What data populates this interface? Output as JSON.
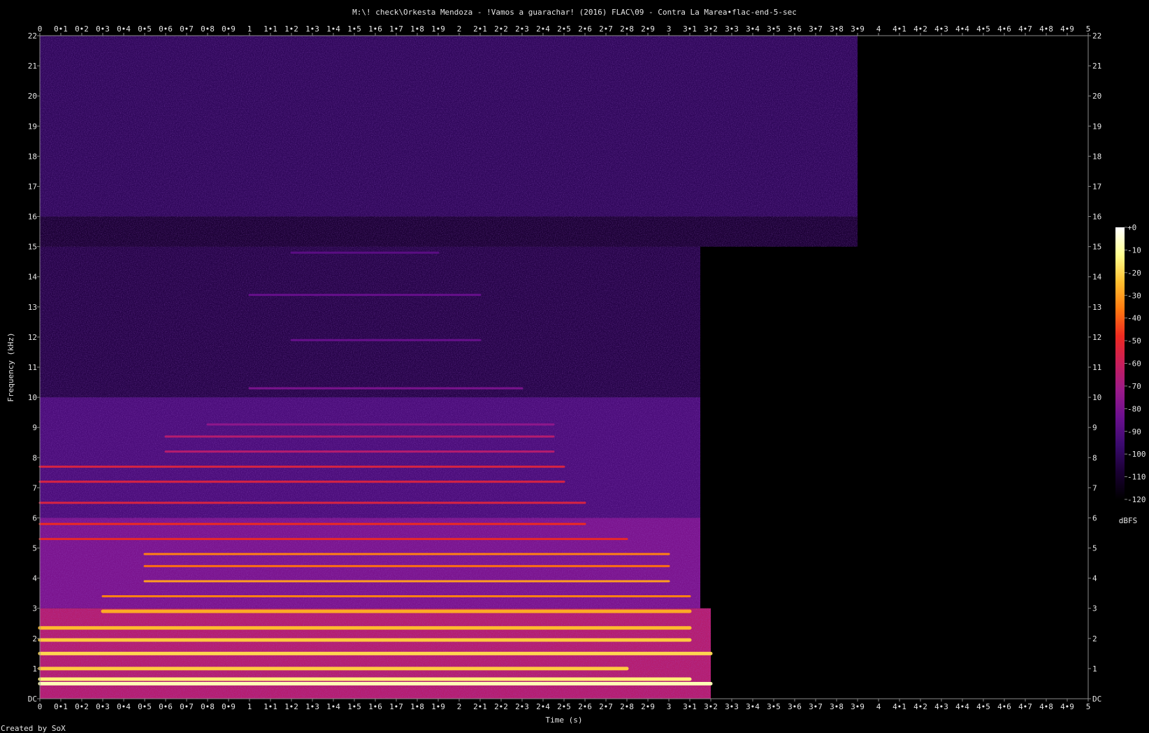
{
  "chart_data": {
    "type": "heatmap",
    "title": "M:\\! check\\Orkesta Mendoza - !Vamos a guarachar! (2016) FLAC\\09 - Contra La Marea•flac-end-5-sec",
    "xlabel": "Time (s)",
    "ylabel": "Frequency (kHz)",
    "xlim": [
      0,
      5
    ],
    "ylim": [
      0,
      22
    ],
    "x_ticks": [
      "0",
      "0•1",
      "0•2",
      "0•3",
      "0•4",
      "0•5",
      "0•6",
      "0•7",
      "0•8",
      "0•9",
      "1",
      "1•1",
      "1•2",
      "1•3",
      "1•4",
      "1•5",
      "1•6",
      "1•7",
      "1•8",
      "1•9",
      "2",
      "2•1",
      "2•2",
      "2•3",
      "2•4",
      "2•5",
      "2•6",
      "2•7",
      "2•8",
      "2•9",
      "3",
      "3•1",
      "3•2",
      "3•3",
      "3•4",
      "3•5",
      "3•6",
      "3•7",
      "3•8",
      "3•9",
      "4",
      "4•1",
      "4•2",
      "4•3",
      "4•4",
      "4•5",
      "4•6",
      "4•7",
      "4•8",
      "4•9",
      "5"
    ],
    "y_ticks": [
      "DC",
      "1",
      "2",
      "3",
      "4",
      "5",
      "6",
      "7",
      "8",
      "9",
      "10",
      "11",
      "12",
      "13",
      "14",
      "15",
      "16",
      "17",
      "18",
      "19",
      "20",
      "21",
      "22"
    ],
    "colorbar": {
      "label": "dBFS",
      "ticks": [
        "+0",
        "-10",
        "-20",
        "-30",
        "-40",
        "-50",
        "-60",
        "-70",
        "-80",
        "-90",
        "-100",
        "-110",
        "-120"
      ],
      "range": [
        -120,
        0
      ],
      "colors": [
        "#000000",
        "#1a0033",
        "#3a0a6e",
        "#6a0f8e",
        "#9a1a8a",
        "#c81e5a",
        "#ee2a20",
        "#ff7a10",
        "#ffc030",
        "#ffff90",
        "#ffffff"
      ]
    },
    "regions": [
      {
        "t_start": 0,
        "t_end": 3.9,
        "f_low": 16,
        "f_high": 22,
        "level_db": -100
      },
      {
        "t_start": 0,
        "t_end": 3.9,
        "f_low": 15,
        "f_high": 16,
        "level_db": -108
      },
      {
        "t_start": 0,
        "t_end": 3.15,
        "f_low": 10,
        "f_high": 15,
        "level_db": -104
      },
      {
        "t_start": 0,
        "t_end": 3.15,
        "f_low": 6,
        "f_high": 10,
        "level_db": -92
      },
      {
        "t_start": 0,
        "t_end": 3.15,
        "f_low": 3,
        "f_high": 6,
        "level_db": -80
      },
      {
        "t_start": 0,
        "t_end": 3.2,
        "f_low": 0,
        "f_high": 3,
        "level_db": -65
      }
    ],
    "harmonics": [
      {
        "freq_khz": 0.5,
        "t_start": 0,
        "t_end": 3.2,
        "level_db": -8
      },
      {
        "freq_khz": 0.65,
        "t_start": 0,
        "t_end": 3.1,
        "level_db": -15
      },
      {
        "freq_khz": 1.0,
        "t_start": 0,
        "t_end": 2.8,
        "level_db": -22
      },
      {
        "freq_khz": 1.5,
        "t_start": 0,
        "t_end": 3.2,
        "level_db": -20
      },
      {
        "freq_khz": 1.95,
        "t_start": 0,
        "t_end": 3.1,
        "level_db": -22
      },
      {
        "freq_khz": 2.35,
        "t_start": 0,
        "t_end": 3.1,
        "level_db": -25
      },
      {
        "freq_khz": 2.9,
        "t_start": 0.3,
        "t_end": 3.1,
        "level_db": -28
      },
      {
        "freq_khz": 3.4,
        "t_start": 0.3,
        "t_end": 3.1,
        "level_db": -35
      },
      {
        "freq_khz": 3.9,
        "t_start": 0.5,
        "t_end": 3.0,
        "level_db": -30
      },
      {
        "freq_khz": 4.4,
        "t_start": 0.5,
        "t_end": 3.0,
        "level_db": -38
      },
      {
        "freq_khz": 4.8,
        "t_start": 0.5,
        "t_end": 3.0,
        "level_db": -35
      },
      {
        "freq_khz": 5.3,
        "t_start": 0,
        "t_end": 2.8,
        "level_db": -50
      },
      {
        "freq_khz": 5.8,
        "t_start": 0,
        "t_end": 2.6,
        "level_db": -48
      },
      {
        "freq_khz": 6.5,
        "t_start": 0,
        "t_end": 2.6,
        "level_db": -55
      },
      {
        "freq_khz": 7.2,
        "t_start": 0,
        "t_end": 2.5,
        "level_db": -55
      },
      {
        "freq_khz": 7.7,
        "t_start": 0,
        "t_end": 2.5,
        "level_db": -55
      },
      {
        "freq_khz": 8.2,
        "t_start": 0.6,
        "t_end": 2.45,
        "level_db": -65
      },
      {
        "freq_khz": 8.7,
        "t_start": 0.6,
        "t_end": 2.45,
        "level_db": -65
      },
      {
        "freq_khz": 9.1,
        "t_start": 0.8,
        "t_end": 2.45,
        "level_db": -75
      },
      {
        "freq_khz": 10.3,
        "t_start": 1.0,
        "t_end": 2.3,
        "level_db": -80
      },
      {
        "freq_khz": 11.9,
        "t_start": 1.2,
        "t_end": 2.1,
        "level_db": -85
      },
      {
        "freq_khz": 13.4,
        "t_start": 1.0,
        "t_end": 2.1,
        "level_db": -85
      },
      {
        "freq_khz": 14.8,
        "t_start": 1.2,
        "t_end": 1.9,
        "level_db": -88
      }
    ]
  },
  "footer": {
    "credit": "Created by SoX"
  }
}
